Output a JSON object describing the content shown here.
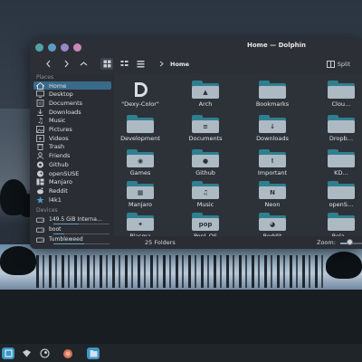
{
  "window": {
    "title": "Home — Dolphin",
    "controls": [
      {
        "name": "close",
        "color": "#4fa3a8"
      },
      {
        "name": "minimize",
        "color": "#5d9cc2"
      },
      {
        "name": "maximize",
        "color": "#9a86c9"
      },
      {
        "name": "pin",
        "color": "#c987b6"
      }
    ]
  },
  "toolbar": {
    "back": "back-icon",
    "forward": "forward-icon",
    "up": "up-icon",
    "view_icons": "icons-view-icon",
    "view_compact": "compact-view-icon",
    "view_details": "details-view-icon",
    "breadcrumb": "Home",
    "split_label": "Split"
  },
  "sidebar": {
    "places_header": "Places",
    "places": [
      {
        "label": "Home",
        "icon": "home-icon",
        "selected": true
      },
      {
        "label": "Desktop",
        "icon": "desktop-icon"
      },
      {
        "label": "Documents",
        "icon": "documents-icon"
      },
      {
        "label": "Downloads",
        "icon": "downloads-icon"
      },
      {
        "label": "Music",
        "icon": "music-icon"
      },
      {
        "label": "Pictures",
        "icon": "pictures-icon"
      },
      {
        "label": "Videos",
        "icon": "videos-icon"
      },
      {
        "label": "Trash",
        "icon": "trash-icon"
      },
      {
        "label": "Friends",
        "icon": "friends-icon"
      },
      {
        "label": "Github",
        "icon": "github-icon"
      },
      {
        "label": "openSUSE",
        "icon": "opensuse-icon"
      },
      {
        "label": "Manjaro",
        "icon": "manjaro-icon"
      },
      {
        "label": "Reddit",
        "icon": "reddit-icon"
      },
      {
        "label": "l4k1",
        "icon": "star-icon"
      }
    ],
    "devices_header": "Devices",
    "devices": [
      {
        "label": "149.5 GiB Interna…",
        "icon": "drive-icon",
        "usage": 0.45
      },
      {
        "label": "boot",
        "icon": "drive-icon",
        "usage": 0.2
      },
      {
        "label": "Tumbleweed",
        "icon": "drive-icon",
        "usage": 0.55
      }
    ]
  },
  "folders": [
    {
      "label": "\"Dexy-Color\"",
      "glyph": "",
      "logo": true
    },
    {
      "label": "Arch",
      "glyph": "▲"
    },
    {
      "label": "Bookmarks",
      "glyph": ""
    },
    {
      "label": "Clou…",
      "glyph": ""
    },
    {
      "label": "Development",
      "glyph": ""
    },
    {
      "label": "Documents",
      "glyph": "≡"
    },
    {
      "label": "Downloads",
      "glyph": "↓"
    },
    {
      "label": "Dropb…",
      "glyph": ""
    },
    {
      "label": "Games",
      "glyph": "◉"
    },
    {
      "label": "Github",
      "glyph": "●"
    },
    {
      "label": "Important",
      "glyph": "!"
    },
    {
      "label": "KD…",
      "glyph": ""
    },
    {
      "label": "Manjaro",
      "glyph": "▦"
    },
    {
      "label": "Music",
      "glyph": "♫"
    },
    {
      "label": "Neon",
      "glyph": "N"
    },
    {
      "label": "openS…",
      "glyph": ""
    },
    {
      "label": "Plasma",
      "glyph": "✦"
    },
    {
      "label": "Popl_OS",
      "glyph": "pop"
    },
    {
      "label": "Reddit",
      "glyph": "◕"
    },
    {
      "label": "Rela…",
      "glyph": ""
    }
  ],
  "status": {
    "count_text": "25 Folders",
    "zoom_label": "Zoom:",
    "zoom_level": 0.35
  },
  "taskbar": {
    "icons": [
      {
        "name": "app-launcher-icon",
        "color": "#3b97c6"
      },
      {
        "name": "files-icon",
        "color": "#c7ccd1"
      },
      {
        "name": "steam-icon",
        "color": "#c7ccd1"
      },
      {
        "name": "browser-icon",
        "color": "#d9735a"
      },
      {
        "name": "dolphin-icon",
        "color": "#3b97c6"
      }
    ]
  }
}
